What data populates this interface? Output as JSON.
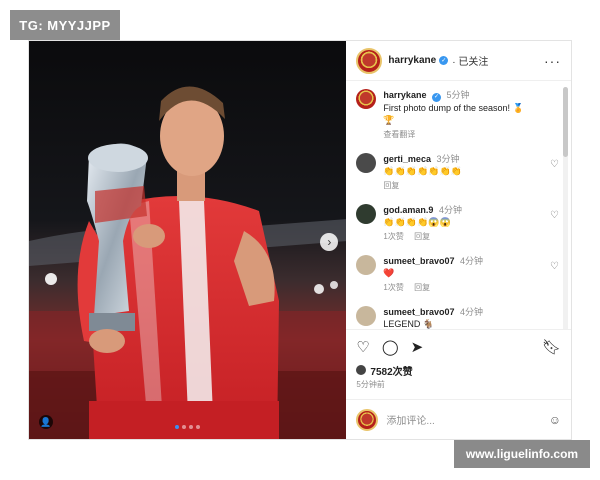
{
  "watermarks": {
    "top_left": "TG: MYYJJPP",
    "bottom_right": "www.liguelinfo.com"
  },
  "post": {
    "header": {
      "username": "harrykane",
      "follow_label": "· 已关注",
      "more_label": "···"
    },
    "caption": {
      "username": "harrykane",
      "time": "5分钟",
      "text": "First photo dump of the season! 🏅",
      "trophy": "🏆",
      "translate": "查看翻译"
    },
    "comments": [
      {
        "username": "gerti_meca",
        "time": "3分钟",
        "text": "👏👏👏👏👏👏👏",
        "reply": "回复",
        "likes": ""
      },
      {
        "username": "god.aman.9",
        "time": "4分钟",
        "text": "👏👏👏👏😱😱",
        "likes": "1次赞",
        "reply": "回复"
      },
      {
        "username": "sumeet_bravo07",
        "time": "4分钟",
        "text": "❤️",
        "likes": "1次赞",
        "reply": "回复"
      },
      {
        "username": "sumeet_bravo07",
        "time": "4分钟",
        "text": "LEGEND 🐐",
        "likes": "",
        "reply": ""
      }
    ],
    "likes": "7582次赞",
    "posted": "5分钟前",
    "add_comment_placeholder": "添加评论...",
    "icons": {
      "like": "heart-icon",
      "comment": "comment-icon",
      "share": "send-icon",
      "save": "bookmark-icon",
      "emoji": "emoji-icon"
    },
    "carousel": {
      "current": 1,
      "total": 4
    }
  }
}
